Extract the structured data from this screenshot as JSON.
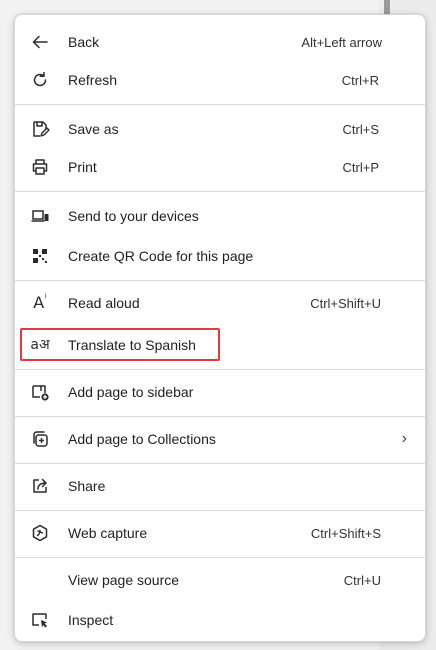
{
  "menu": {
    "items": [
      {
        "label": "Back",
        "shortcut": "Alt+Left arrow",
        "icon": "back-arrow-icon"
      },
      {
        "label": "Refresh",
        "shortcut": "Ctrl+R",
        "icon": "refresh-icon"
      },
      {
        "label": "Save as",
        "shortcut": "Ctrl+S",
        "icon": "save-as-icon"
      },
      {
        "label": "Print",
        "shortcut": "Ctrl+P",
        "icon": "print-icon"
      },
      {
        "label": "Send to your devices",
        "shortcut": "",
        "icon": "send-to-devices-icon"
      },
      {
        "label": "Create QR Code for this page",
        "shortcut": "",
        "icon": "qr-code-icon"
      },
      {
        "label": "Read aloud",
        "shortcut": "Ctrl+Shift+U",
        "icon": "read-aloud-icon"
      },
      {
        "label": "Translate to Spanish",
        "shortcut": "",
        "icon": "translate-icon"
      },
      {
        "label": "Add page to sidebar",
        "shortcut": "",
        "icon": "add-to-sidebar-icon"
      },
      {
        "label": "Add page to Collections",
        "shortcut": "",
        "icon": "collections-icon",
        "submenu": "›"
      },
      {
        "label": "Share",
        "shortcut": "",
        "icon": "share-icon"
      },
      {
        "label": "Web capture",
        "shortcut": "Ctrl+Shift+S",
        "icon": "web-capture-icon"
      },
      {
        "label": "View page source",
        "shortcut": "Ctrl+U",
        "icon": ""
      },
      {
        "label": "Inspect",
        "shortcut": "",
        "icon": "inspect-icon"
      }
    ],
    "read_aloud_glyph": "A",
    "read_aloud_glyph_mark": "⁾",
    "translate_glyph": "aअ"
  },
  "colors": {
    "highlight_border": "#e23b3b",
    "menu_background": "#ffffff",
    "divider": "#dadada"
  }
}
